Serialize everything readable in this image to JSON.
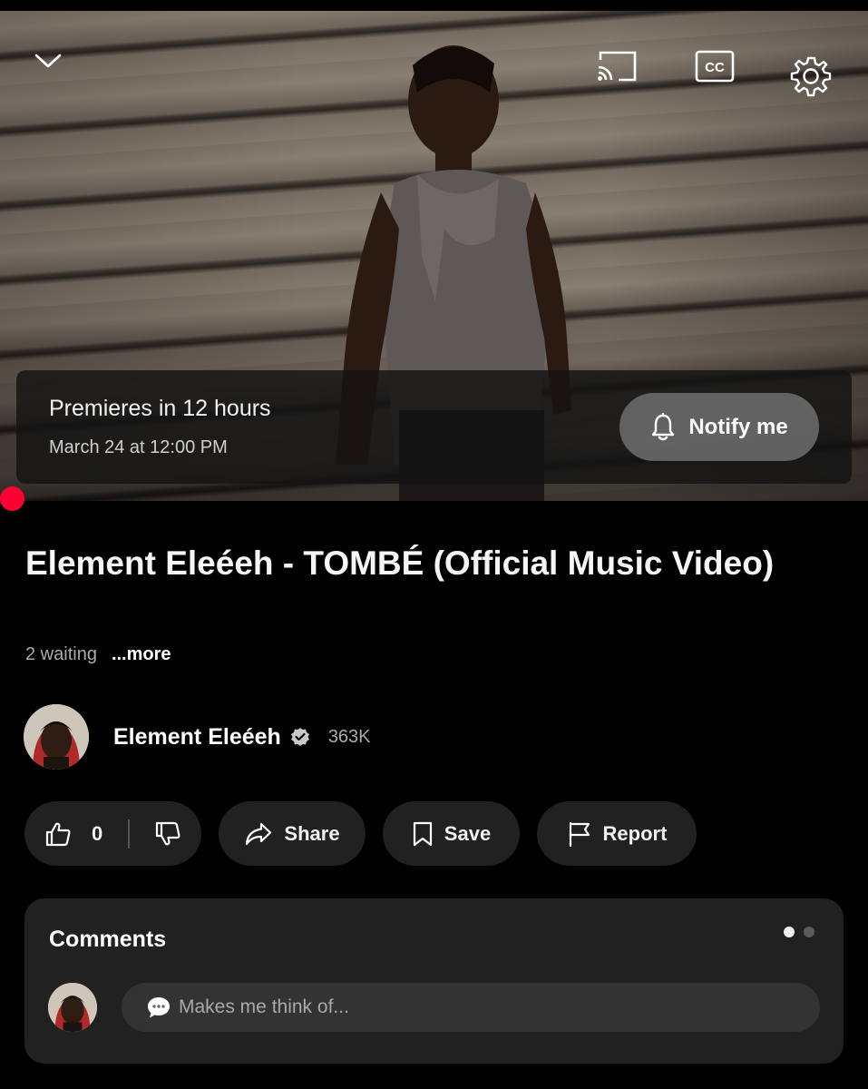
{
  "player": {
    "icons": {
      "collapse": "chevron-down-icon",
      "cast": "cast-icon",
      "captions": "captions-icon",
      "settings": "gear-icon"
    },
    "captions_label": "CC",
    "premiere": {
      "title": "Premieres in 12 hours",
      "date": "March 24 at 12:00 PM",
      "notify_label": "Notify me"
    },
    "accent_color": "#ff0033"
  },
  "video": {
    "title": "Element Eleéeh - TOMBÉ (Official Music Video)",
    "waiting": "2 waiting",
    "more_label": "...more"
  },
  "channel": {
    "name": "Element Eleéeh",
    "verified": true,
    "subscribers": "363K"
  },
  "actions": {
    "like_count": "0",
    "share_label": "Share",
    "save_label": "Save",
    "report_label": "Report"
  },
  "comments": {
    "title": "Comments",
    "input_placeholder": "Makes me think of...",
    "pager": {
      "count": 2,
      "active": 1
    }
  }
}
